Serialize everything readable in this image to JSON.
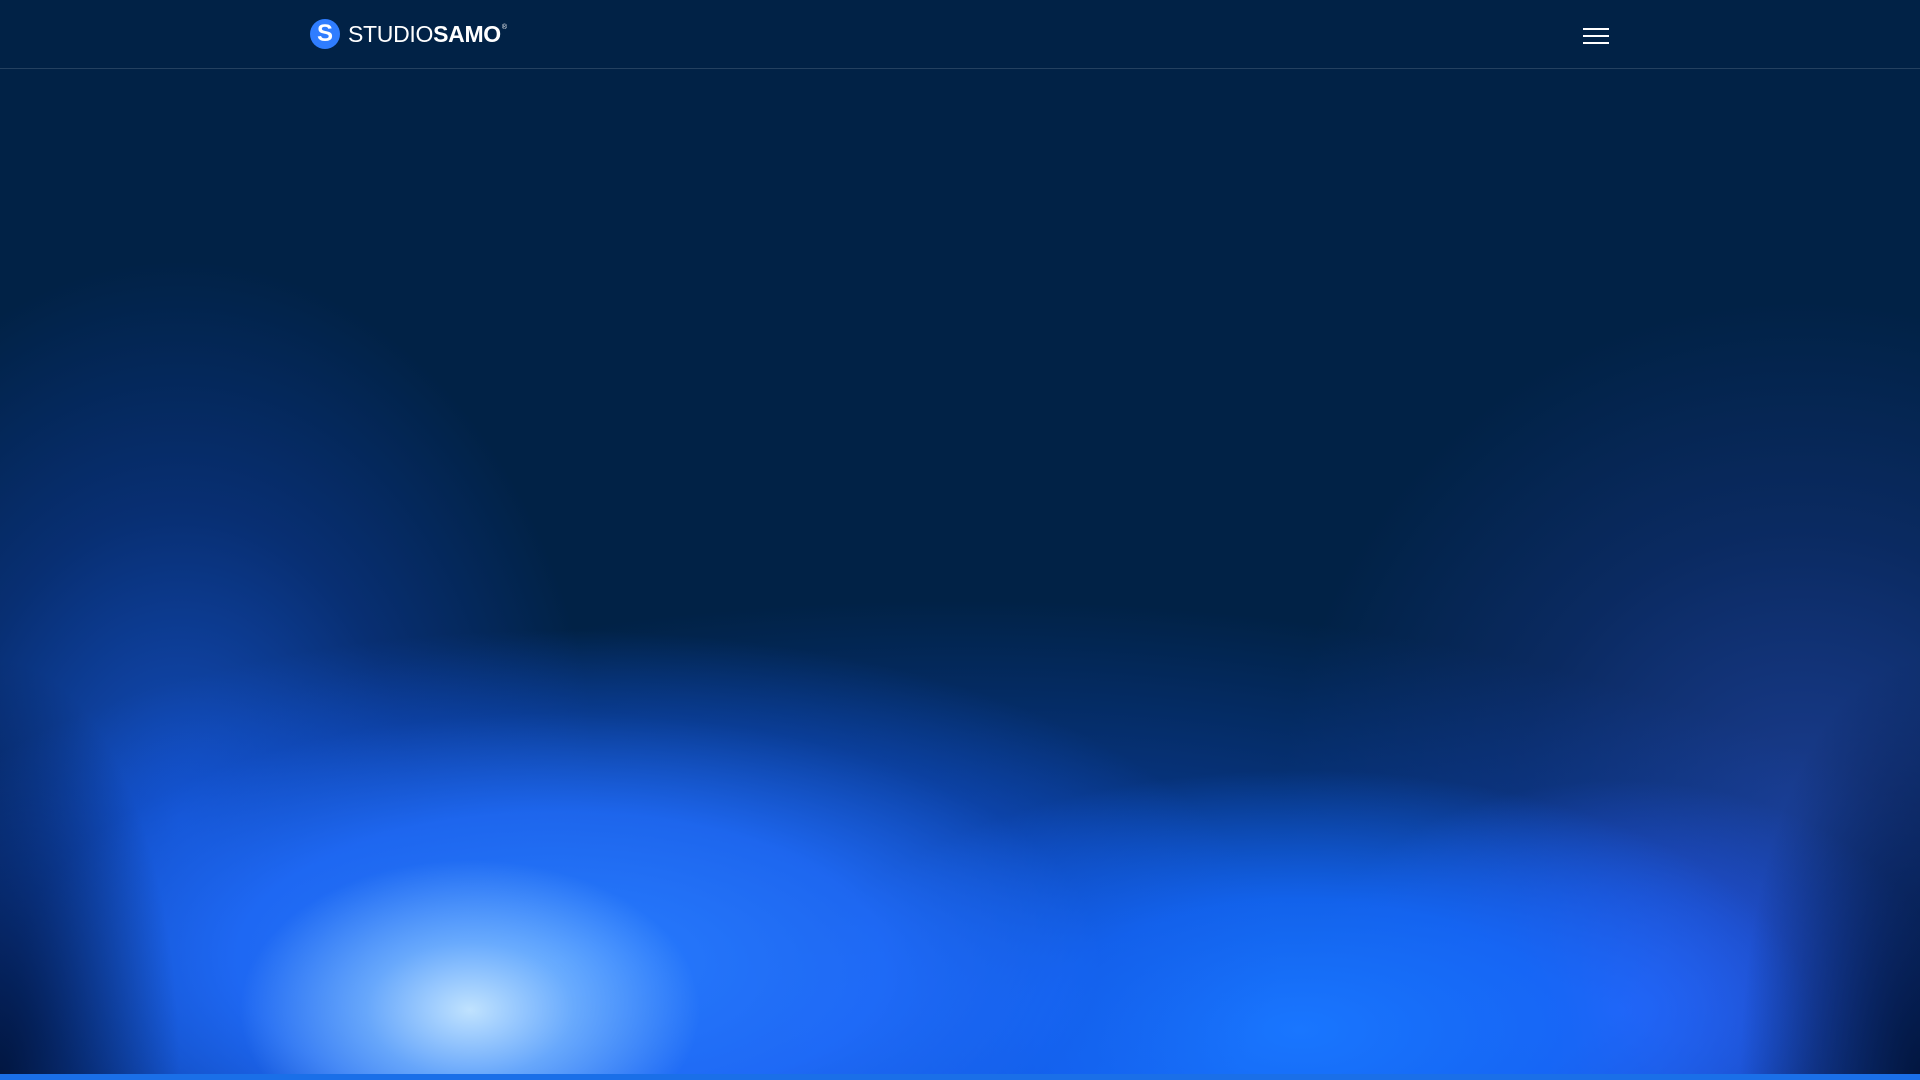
{
  "header": {
    "logo": {
      "mark_letter": "S",
      "text_light": "STUDIO",
      "text_bold": "SAMO",
      "registered_mark": "®",
      "icon": "studiosamo-logo"
    },
    "menu_button": {
      "icon": "hamburger-menu-icon"
    }
  },
  "hero": {
    "background_color": "#012246",
    "accent_color": "#1a6fe8",
    "glow_colors": [
      "#287dff",
      "#c8e8ff",
      "#3764ff"
    ]
  }
}
